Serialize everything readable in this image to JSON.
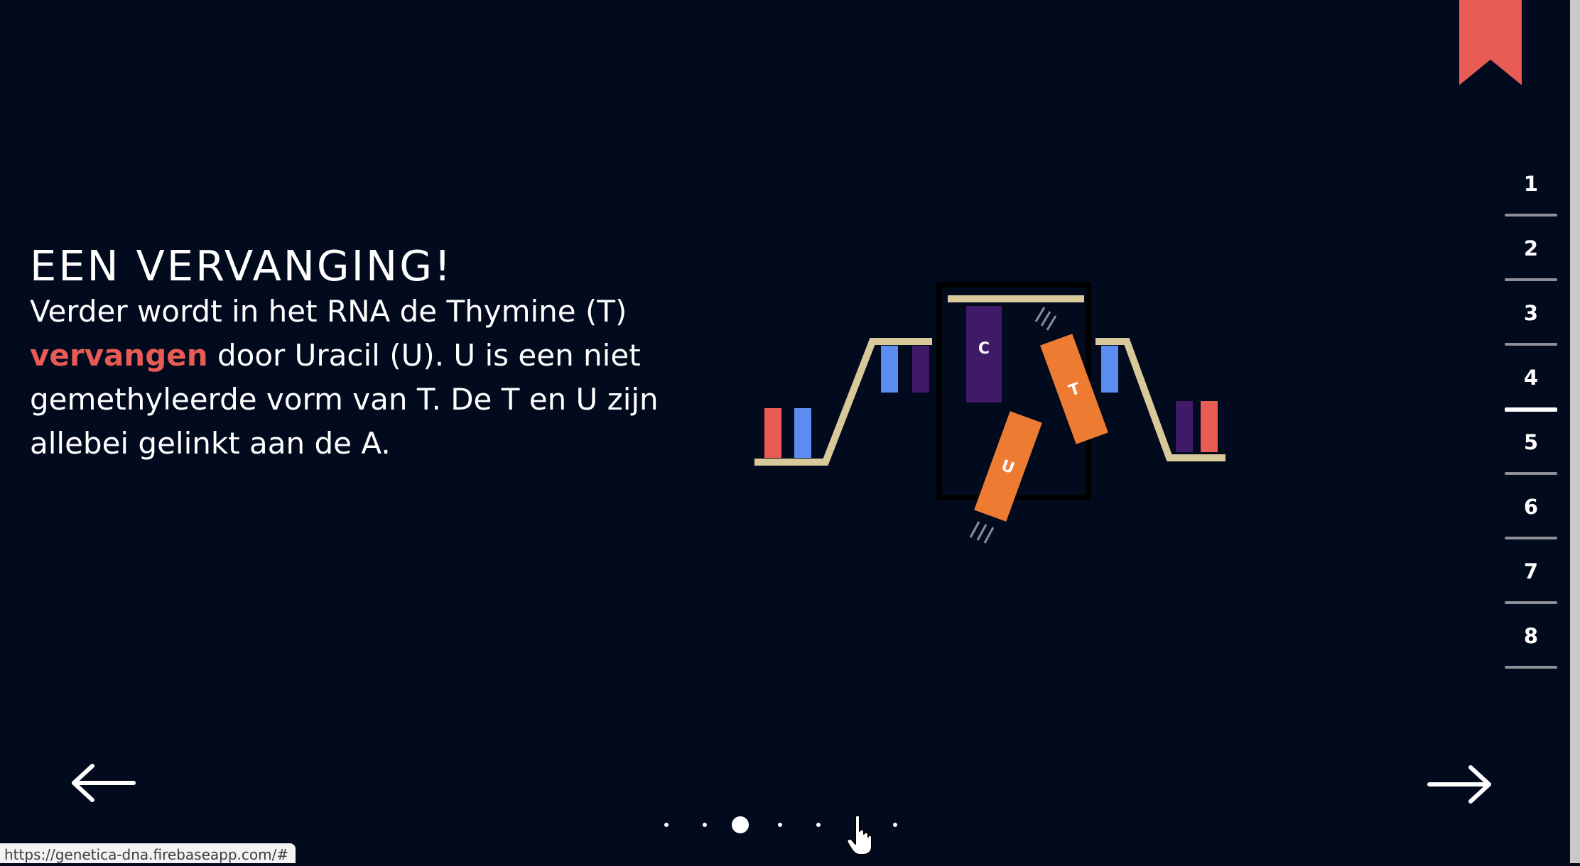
{
  "slide": {
    "heading": "EEN VERVANGING!",
    "body_before": "Verder wordt in het RNA de Thymine (T) ",
    "highlight": "vervangen",
    "body_after": " door Uracil (U). U is een niet gemethyleerde vorm van T. De T en U zijn allebei gelinkt aan de A."
  },
  "illustration": {
    "label_c": "C",
    "label_t": "T",
    "label_u": "U"
  },
  "side_nav": {
    "items": [
      {
        "label": "1"
      },
      {
        "label": "2"
      },
      {
        "label": "3"
      },
      {
        "label": "4"
      },
      {
        "label": "5"
      },
      {
        "label": "6"
      },
      {
        "label": "7"
      },
      {
        "label": "8"
      }
    ],
    "active_index": 3
  },
  "pagination": {
    "count": 7,
    "active_index": 2
  },
  "status_bar": {
    "url": "https://genetica-dna.firebaseapp.com/#"
  },
  "colors": {
    "background": "#020a1e",
    "accent_red": "#e95b55",
    "bookmark": "#e95b55",
    "strand": "#d8c99a",
    "base_blue": "#5c8cf0",
    "base_purple": "#3f1a66",
    "base_orange": "#ee7b32"
  },
  "icons": {
    "bookmark": "bookmark-ribbon-icon",
    "prev": "arrow-left-icon",
    "next": "arrow-right-icon",
    "cursor": "hand-pointer-icon"
  }
}
